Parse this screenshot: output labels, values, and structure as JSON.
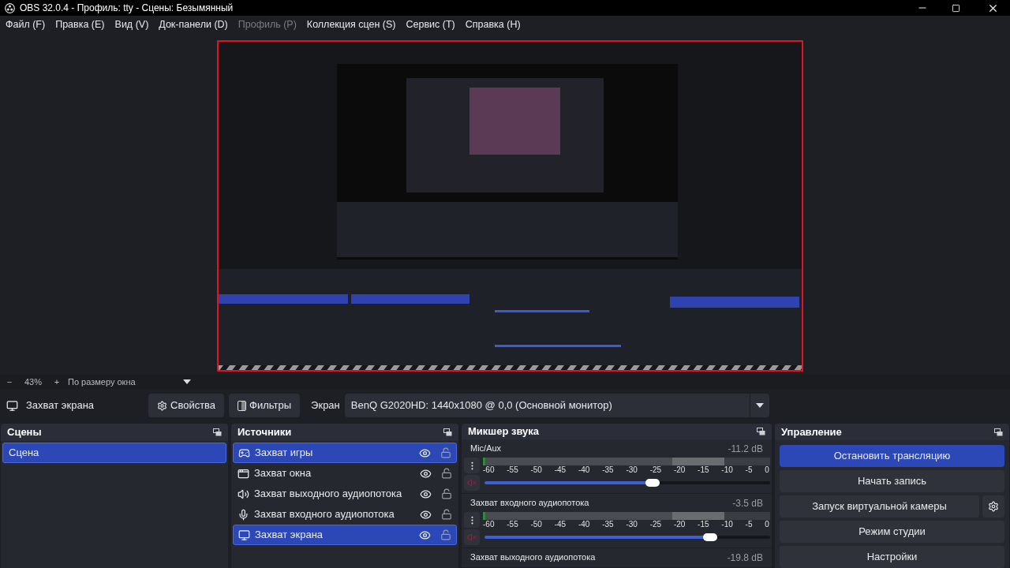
{
  "window": {
    "title": "OBS 32.0.4 - Профиль: tty - Сцены: Безымянный"
  },
  "menu": [
    {
      "label": "Файл (F)",
      "disabled": false
    },
    {
      "label": "Правка (E)",
      "disabled": false
    },
    {
      "label": "Вид (V)",
      "disabled": false
    },
    {
      "label": "Док-панели (D)",
      "disabled": false
    },
    {
      "label": "Профиль (P)",
      "disabled": true
    },
    {
      "label": "Коллекция сцен (S)",
      "disabled": false
    },
    {
      "label": "Сервис (T)",
      "disabled": false
    },
    {
      "label": "Справка (H)",
      "disabled": false
    }
  ],
  "zoom_bar": {
    "minus": "−",
    "zoom": "43%",
    "plus": "+",
    "fit": "По размеру окна"
  },
  "source_bar": {
    "source": "Захват экрана",
    "properties": "Свойства",
    "filters": "Фильтры",
    "screen_label": "Экран",
    "screen_value": "BenQ G2020HD: 1440x1080 @ 0,0 (Основной монитор)"
  },
  "scenes": {
    "title": "Сцены",
    "items": [
      {
        "label": "Сцена",
        "selected": true
      }
    ]
  },
  "sources": {
    "title": "Источники",
    "items": [
      {
        "label": "Захват игры",
        "kind": "game",
        "selected": true,
        "visible": true,
        "locked": false
      },
      {
        "label": "Захват окна",
        "kind": "window",
        "selected": false,
        "visible": true,
        "locked": false
      },
      {
        "label": "Захват выходного аудиопотока",
        "kind": "speaker",
        "selected": false,
        "visible": true,
        "locked": false
      },
      {
        "label": "Захват входного аудиопотока",
        "kind": "mic",
        "selected": false,
        "visible": true,
        "locked": false
      },
      {
        "label": "Захват экрана",
        "kind": "monitor",
        "selected": true,
        "visible": true,
        "locked": false
      }
    ]
  },
  "mixer": {
    "title": "Микшер звука",
    "channels": [
      {
        "name": "Mic/Aux",
        "reading": "-11.2 dB",
        "level": 0.61,
        "muted": true,
        "ticks": [
          "-60",
          "-55",
          "-50",
          "-45",
          "-40",
          "-35",
          "-30",
          "-25",
          "-20",
          "-15",
          "-10",
          "-5",
          "0"
        ]
      },
      {
        "name": "Захват входного аудиопотока",
        "reading": "-3.5 dB",
        "level": 0.81,
        "muted": true,
        "ticks": [
          "-60",
          "-55",
          "-50",
          "-45",
          "-40",
          "-35",
          "-30",
          "-25",
          "-20",
          "-15",
          "-10",
          "-5",
          "0"
        ]
      },
      {
        "name": "Захват выходного аудиопотока",
        "reading": "-19.8 dB"
      }
    ]
  },
  "controls": {
    "title": "Управление",
    "buttons": [
      {
        "label": "Остановить трансляцию",
        "active": true,
        "settings": false
      },
      {
        "label": "Начать запись",
        "active": false,
        "settings": false
      },
      {
        "label": "Запуск виртуальной камеры",
        "active": false,
        "settings": true
      },
      {
        "label": "Режим студии",
        "active": false,
        "settings": false
      },
      {
        "label": "Настройки",
        "active": false,
        "settings": false
      }
    ]
  }
}
